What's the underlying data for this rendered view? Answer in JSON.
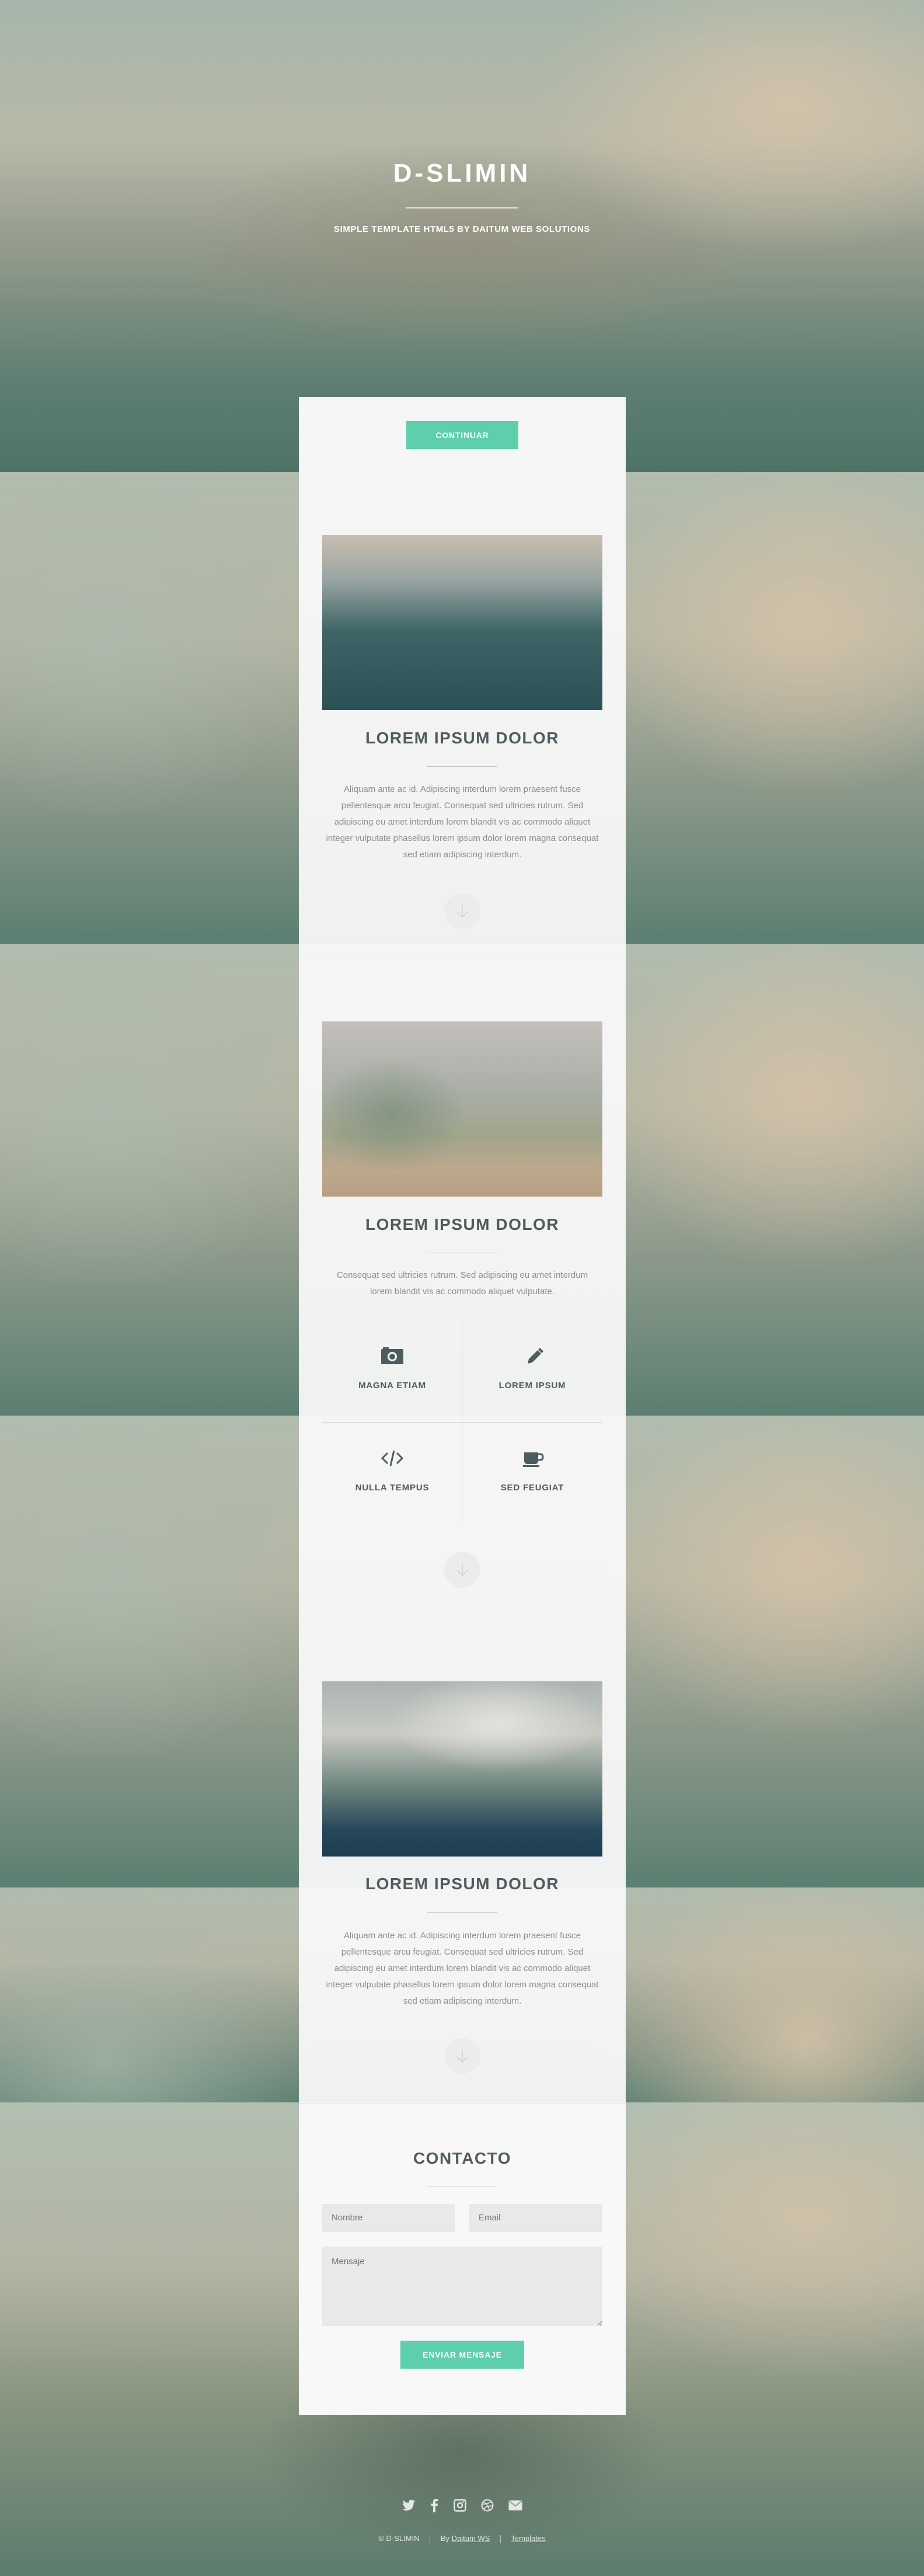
{
  "hero": {
    "title": "D-SLIMIN",
    "subtitle": "SIMPLE TEMPLATE HTML5 BY DAITUM WEB SOLUTIONS",
    "continue_label": "CONTINUAR"
  },
  "sections": [
    {
      "title": "LOREM IPSUM DOLOR",
      "text": "Aliquam ante ac id. Adipiscing interdum lorem praesent fusce pellentesque arcu feugiat. Consequat sed ultricies rutrum. Sed adipiscing eu amet interdum lorem blandit vis ac commodo aliquet integer vulputate phasellus lorem ipsum dolor lorem magna consequat sed etiam adipiscing interdum."
    },
    {
      "title": "LOREM IPSUM DOLOR",
      "text": "Consequat sed ultricies rutrum. Sed adipiscing eu amet interdum lorem blandit vis ac commodo aliquet vulputate.",
      "features": [
        {
          "label": "MAGNA ETIAM",
          "icon": "camera-icon"
        },
        {
          "label": "LOREM IPSUM",
          "icon": "pencil-icon"
        },
        {
          "label": "NULLA TEMPUS",
          "icon": "code-icon"
        },
        {
          "label": "SED FEUGIAT",
          "icon": "coffee-icon"
        }
      ]
    },
    {
      "title": "LOREM IPSUM DOLOR",
      "text": "Aliquam ante ac id. Adipiscing interdum lorem praesent fusce pellentesque arcu feugiat. Consequat sed ultricies rutrum. Sed adipiscing eu amet interdum lorem blandit vis ac commodo aliquet integer vulputate phasellus lorem ipsum dolor lorem magna consequat sed etiam adipiscing interdum."
    }
  ],
  "contact": {
    "title": "CONTACTO",
    "name_placeholder": "Nombre",
    "email_placeholder": "Email",
    "message_placeholder": "Mensaje",
    "send_label": "ENVIAR MENSAJE"
  },
  "footer": {
    "social_icons": [
      "twitter-icon",
      "facebook-icon",
      "instagram-icon",
      "dribbble-icon",
      "email-icon"
    ],
    "copyright": "© D-SLIMIN",
    "by_prefix": "By",
    "by_link": "Daitum WS",
    "templates_link": "Templates"
  },
  "colors": {
    "accent": "#5dcfac",
    "heading": "#4e5b5f",
    "text": "#8b8e90",
    "panel": "#f8f8f8"
  }
}
